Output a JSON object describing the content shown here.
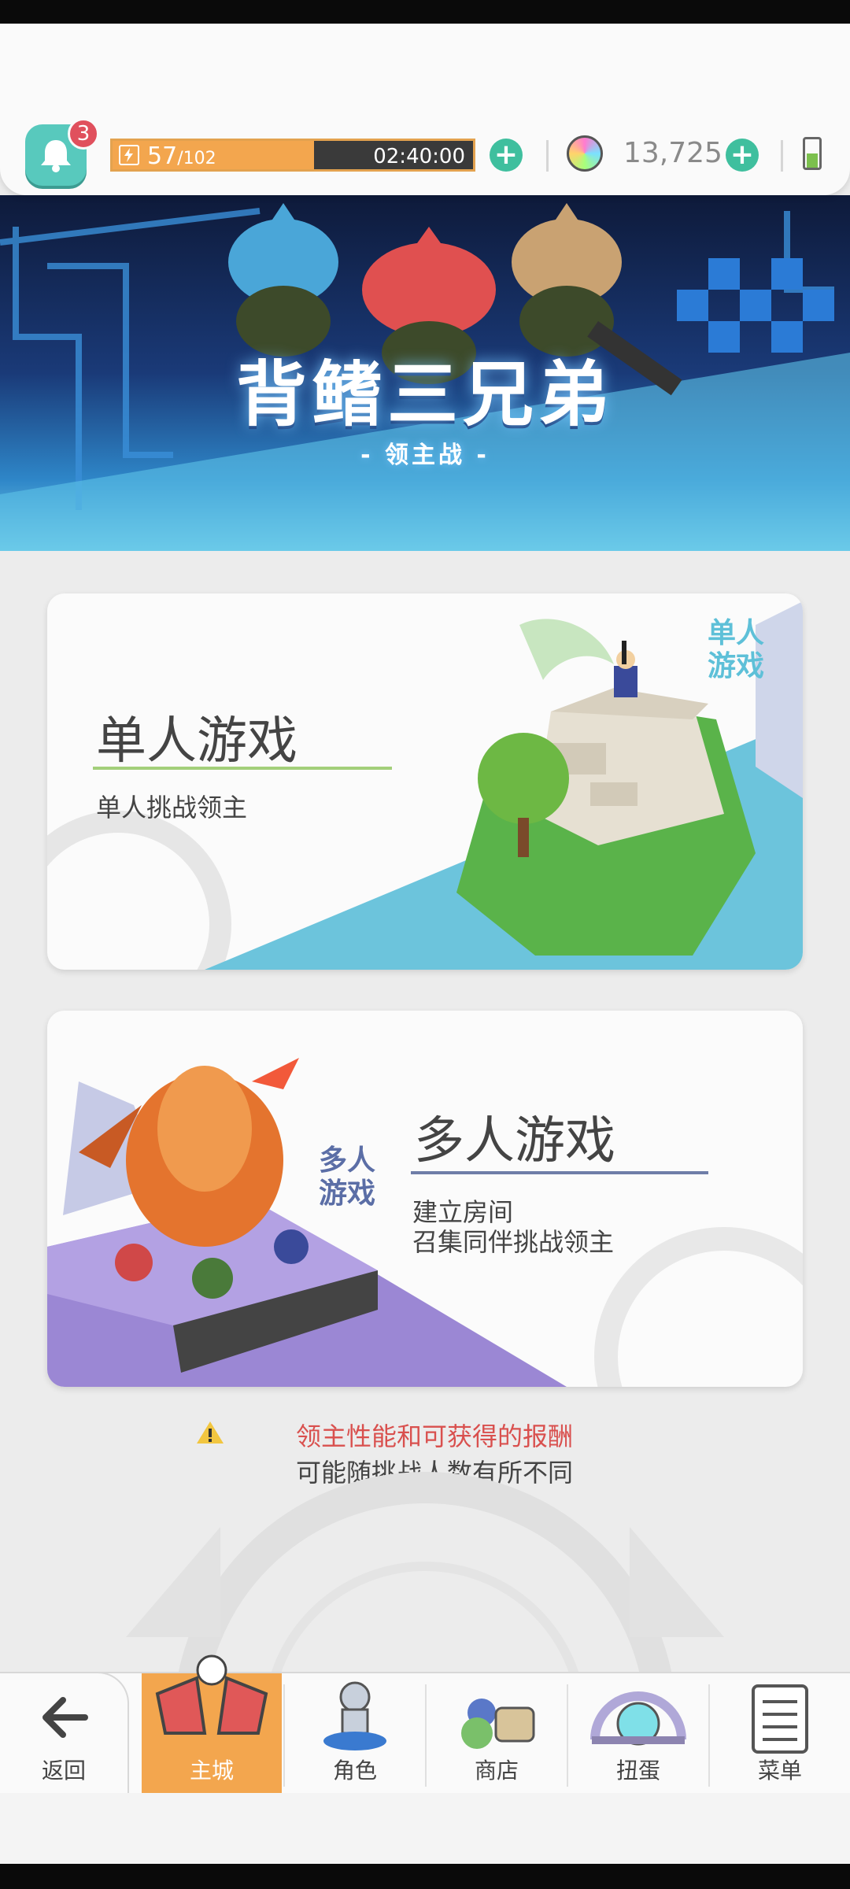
{
  "header": {
    "notification_count": "3",
    "energy_current": "57",
    "energy_max": "/102",
    "energy_fraction": 0.56,
    "energy_timer": "02:40:00",
    "gem_count": "13,725",
    "battery_level": 0.45
  },
  "banner": {
    "title": "背鳍三兄弟",
    "subtitle": "- 领主战 -"
  },
  "modes": [
    {
      "title": "单人游戏",
      "description": "单人挑战领主",
      "badge": "单人\n游戏",
      "accent": "#a3cf7a"
    },
    {
      "title": "多人游戏",
      "description_line1": "建立房间",
      "description_line2": "召集同伴挑战领主",
      "badge": "多人\n游戏",
      "accent": "#6f7ea8"
    }
  ],
  "notice": {
    "line1": "领主性能和可获得的报酬",
    "line2": "可能随挑战人数有所不同"
  },
  "nav": {
    "back": "返回",
    "items": [
      "主城",
      "角色",
      "商店",
      "扭蛋",
      "菜单"
    ],
    "active_index": 0
  },
  "colors": {
    "accent_orange": "#f3a64e",
    "teal": "#58c9bd",
    "badge_red": "#e0505d",
    "plus_green": "#3fbf9e",
    "warning_red": "#d9504e"
  }
}
